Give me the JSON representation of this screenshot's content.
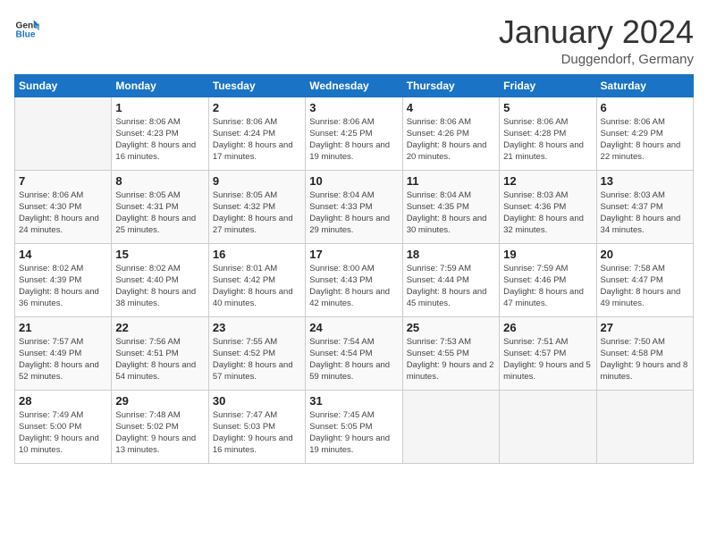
{
  "header": {
    "logo_general": "General",
    "logo_blue": "Blue",
    "month": "January 2024",
    "location": "Duggendorf, Germany"
  },
  "days_of_week": [
    "Sunday",
    "Monday",
    "Tuesday",
    "Wednesday",
    "Thursday",
    "Friday",
    "Saturday"
  ],
  "weeks": [
    [
      {
        "num": "",
        "sunrise": "",
        "sunset": "",
        "daylight": ""
      },
      {
        "num": "1",
        "sunrise": "Sunrise: 8:06 AM",
        "sunset": "Sunset: 4:23 PM",
        "daylight": "Daylight: 8 hours and 16 minutes."
      },
      {
        "num": "2",
        "sunrise": "Sunrise: 8:06 AM",
        "sunset": "Sunset: 4:24 PM",
        "daylight": "Daylight: 8 hours and 17 minutes."
      },
      {
        "num": "3",
        "sunrise": "Sunrise: 8:06 AM",
        "sunset": "Sunset: 4:25 PM",
        "daylight": "Daylight: 8 hours and 19 minutes."
      },
      {
        "num": "4",
        "sunrise": "Sunrise: 8:06 AM",
        "sunset": "Sunset: 4:26 PM",
        "daylight": "Daylight: 8 hours and 20 minutes."
      },
      {
        "num": "5",
        "sunrise": "Sunrise: 8:06 AM",
        "sunset": "Sunset: 4:28 PM",
        "daylight": "Daylight: 8 hours and 21 minutes."
      },
      {
        "num": "6",
        "sunrise": "Sunrise: 8:06 AM",
        "sunset": "Sunset: 4:29 PM",
        "daylight": "Daylight: 8 hours and 22 minutes."
      }
    ],
    [
      {
        "num": "7",
        "sunrise": "Sunrise: 8:06 AM",
        "sunset": "Sunset: 4:30 PM",
        "daylight": "Daylight: 8 hours and 24 minutes."
      },
      {
        "num": "8",
        "sunrise": "Sunrise: 8:05 AM",
        "sunset": "Sunset: 4:31 PM",
        "daylight": "Daylight: 8 hours and 25 minutes."
      },
      {
        "num": "9",
        "sunrise": "Sunrise: 8:05 AM",
        "sunset": "Sunset: 4:32 PM",
        "daylight": "Daylight: 8 hours and 27 minutes."
      },
      {
        "num": "10",
        "sunrise": "Sunrise: 8:04 AM",
        "sunset": "Sunset: 4:33 PM",
        "daylight": "Daylight: 8 hours and 29 minutes."
      },
      {
        "num": "11",
        "sunrise": "Sunrise: 8:04 AM",
        "sunset": "Sunset: 4:35 PM",
        "daylight": "Daylight: 8 hours and 30 minutes."
      },
      {
        "num": "12",
        "sunrise": "Sunrise: 8:03 AM",
        "sunset": "Sunset: 4:36 PM",
        "daylight": "Daylight: 8 hours and 32 minutes."
      },
      {
        "num": "13",
        "sunrise": "Sunrise: 8:03 AM",
        "sunset": "Sunset: 4:37 PM",
        "daylight": "Daylight: 8 hours and 34 minutes."
      }
    ],
    [
      {
        "num": "14",
        "sunrise": "Sunrise: 8:02 AM",
        "sunset": "Sunset: 4:39 PM",
        "daylight": "Daylight: 8 hours and 36 minutes."
      },
      {
        "num": "15",
        "sunrise": "Sunrise: 8:02 AM",
        "sunset": "Sunset: 4:40 PM",
        "daylight": "Daylight: 8 hours and 38 minutes."
      },
      {
        "num": "16",
        "sunrise": "Sunrise: 8:01 AM",
        "sunset": "Sunset: 4:42 PM",
        "daylight": "Daylight: 8 hours and 40 minutes."
      },
      {
        "num": "17",
        "sunrise": "Sunrise: 8:00 AM",
        "sunset": "Sunset: 4:43 PM",
        "daylight": "Daylight: 8 hours and 42 minutes."
      },
      {
        "num": "18",
        "sunrise": "Sunrise: 7:59 AM",
        "sunset": "Sunset: 4:44 PM",
        "daylight": "Daylight: 8 hours and 45 minutes."
      },
      {
        "num": "19",
        "sunrise": "Sunrise: 7:59 AM",
        "sunset": "Sunset: 4:46 PM",
        "daylight": "Daylight: 8 hours and 47 minutes."
      },
      {
        "num": "20",
        "sunrise": "Sunrise: 7:58 AM",
        "sunset": "Sunset: 4:47 PM",
        "daylight": "Daylight: 8 hours and 49 minutes."
      }
    ],
    [
      {
        "num": "21",
        "sunrise": "Sunrise: 7:57 AM",
        "sunset": "Sunset: 4:49 PM",
        "daylight": "Daylight: 8 hours and 52 minutes."
      },
      {
        "num": "22",
        "sunrise": "Sunrise: 7:56 AM",
        "sunset": "Sunset: 4:51 PM",
        "daylight": "Daylight: 8 hours and 54 minutes."
      },
      {
        "num": "23",
        "sunrise": "Sunrise: 7:55 AM",
        "sunset": "Sunset: 4:52 PM",
        "daylight": "Daylight: 8 hours and 57 minutes."
      },
      {
        "num": "24",
        "sunrise": "Sunrise: 7:54 AM",
        "sunset": "Sunset: 4:54 PM",
        "daylight": "Daylight: 8 hours and 59 minutes."
      },
      {
        "num": "25",
        "sunrise": "Sunrise: 7:53 AM",
        "sunset": "Sunset: 4:55 PM",
        "daylight": "Daylight: 9 hours and 2 minutes."
      },
      {
        "num": "26",
        "sunrise": "Sunrise: 7:51 AM",
        "sunset": "Sunset: 4:57 PM",
        "daylight": "Daylight: 9 hours and 5 minutes."
      },
      {
        "num": "27",
        "sunrise": "Sunrise: 7:50 AM",
        "sunset": "Sunset: 4:58 PM",
        "daylight": "Daylight: 9 hours and 8 minutes."
      }
    ],
    [
      {
        "num": "28",
        "sunrise": "Sunrise: 7:49 AM",
        "sunset": "Sunset: 5:00 PM",
        "daylight": "Daylight: 9 hours and 10 minutes."
      },
      {
        "num": "29",
        "sunrise": "Sunrise: 7:48 AM",
        "sunset": "Sunset: 5:02 PM",
        "daylight": "Daylight: 9 hours and 13 minutes."
      },
      {
        "num": "30",
        "sunrise": "Sunrise: 7:47 AM",
        "sunset": "Sunset: 5:03 PM",
        "daylight": "Daylight: 9 hours and 16 minutes."
      },
      {
        "num": "31",
        "sunrise": "Sunrise: 7:45 AM",
        "sunset": "Sunset: 5:05 PM",
        "daylight": "Daylight: 9 hours and 19 minutes."
      },
      {
        "num": "",
        "sunrise": "",
        "sunset": "",
        "daylight": ""
      },
      {
        "num": "",
        "sunrise": "",
        "sunset": "",
        "daylight": ""
      },
      {
        "num": "",
        "sunrise": "",
        "sunset": "",
        "daylight": ""
      }
    ]
  ]
}
